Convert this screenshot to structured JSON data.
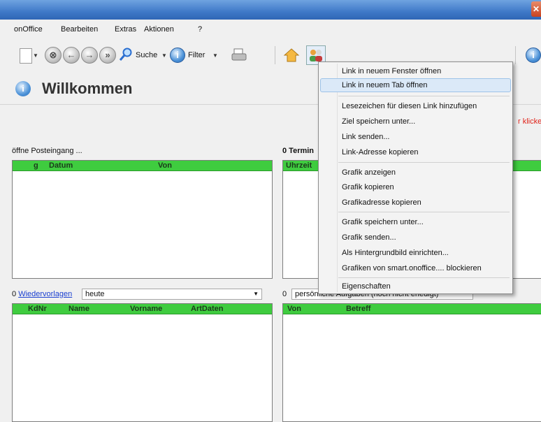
{
  "menubar": [
    "onOffice",
    "Bearbeiten",
    "Extras",
    "Aktionen",
    "?"
  ],
  "window": {
    "close_glyph": "✕"
  },
  "toolbar": {
    "search_label": "Suche",
    "filter_label": "Filter"
  },
  "page": {
    "title": "Willkommen",
    "red_link_text": "r klicken"
  },
  "posteingang": {
    "label": "öffne Posteingang ...",
    "columns": [
      "g",
      "Datum",
      "Von"
    ]
  },
  "termine": {
    "label": "0 Termin",
    "columns": [
      "Uhrzeit"
    ]
  },
  "wiedervorlagen": {
    "count": "0",
    "link": "Wiedervorlagen",
    "filter_value": "heute",
    "columns": [
      "KdNr",
      "Name",
      "Vorname",
      "ArtDaten"
    ]
  },
  "aufgaben": {
    "count": "0",
    "label": "persönliche Aufgaben (noch nicht erledigt)",
    "columns": [
      "Von",
      "Betreff"
    ]
  },
  "context_menu": {
    "items": [
      "Link in neuem Fenster öffnen",
      "Link in neuem Tab öffnen",
      "Lesezeichen für diesen Link hinzufügen",
      "Ziel speichern unter...",
      "Link senden...",
      "Link-Adresse kopieren",
      "Grafik anzeigen",
      "Grafik kopieren",
      "Grafikadresse kopieren",
      "Grafik speichern unter...",
      "Grafik senden...",
      "Als Hintergrundbild einrichten...",
      "Grafiken von smart.onoffice.... blockieren",
      "Eigenschaften"
    ],
    "highlighted": "Link in neuem Tab öffnen"
  },
  "colors": {
    "grid_header": "#3fcc3f",
    "titlebar": "#3f79c8",
    "link": "#1a3fd1",
    "red_link": "#e0241b"
  }
}
